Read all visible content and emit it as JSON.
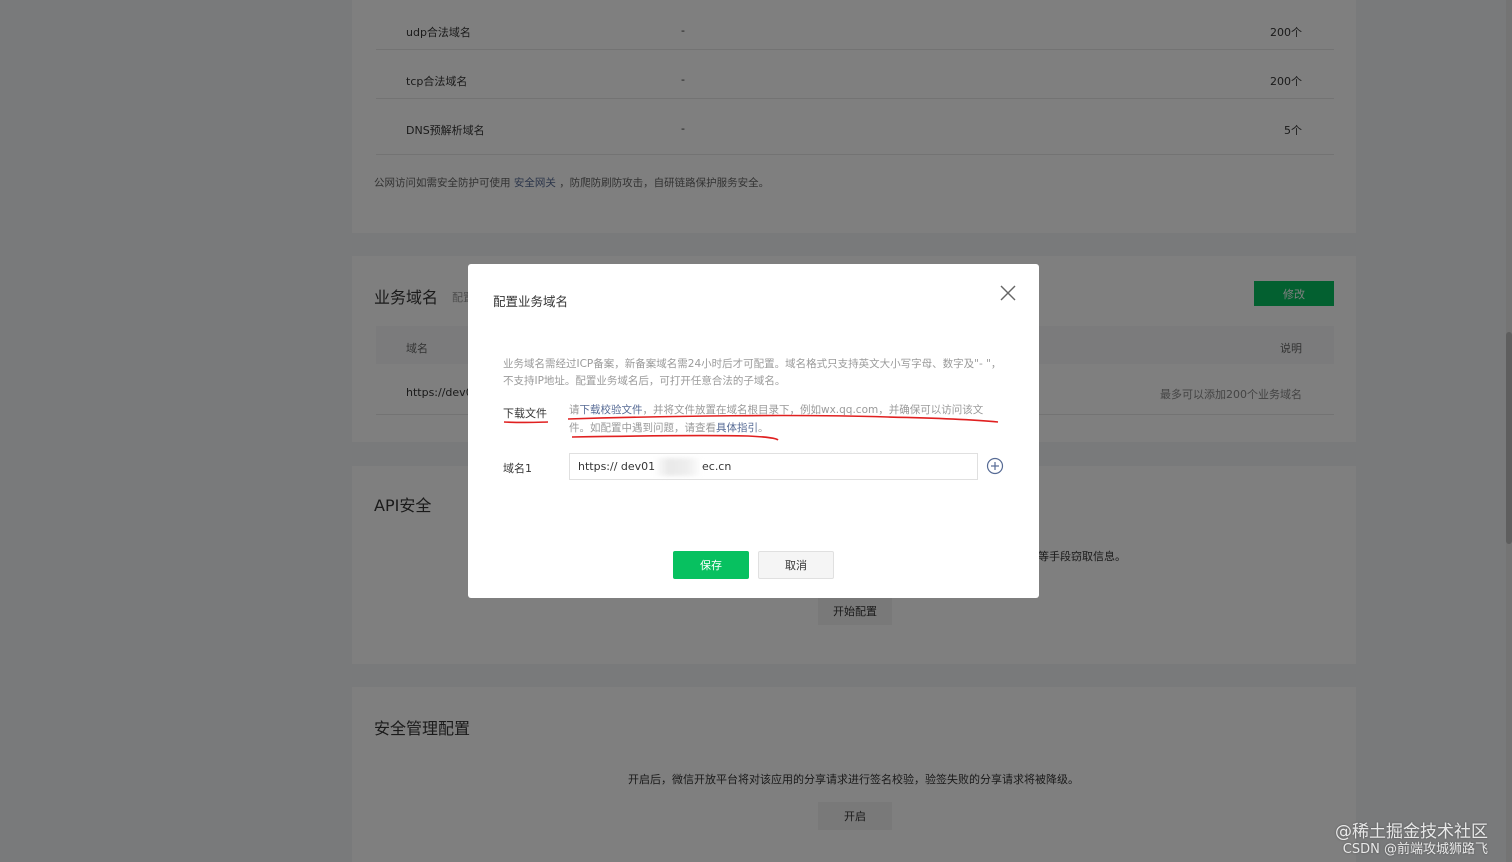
{
  "server_domains": {
    "rows": [
      {
        "name": "udp合法域名",
        "value": "-",
        "count": "200个"
      },
      {
        "name": "tcp合法域名",
        "value": "-",
        "count": "200个"
      },
      {
        "name": "DNS预解析域名",
        "value": "-",
        "count": "5个"
      }
    ],
    "note_prefix": "公网访问如需安全防护可使用",
    "note_link": "安全网关",
    "note_suffix": "，防爬防刷防攻击，自研链路保护服务安全。"
  },
  "business_domain": {
    "title": "业务域名",
    "subtitle": "配置",
    "edit_button": "修改",
    "table_headers": {
      "domain": "域名",
      "desc": "说明"
    },
    "row": {
      "domain": "https://dev0",
      "desc": "最多可以添加200个业务域名"
    }
  },
  "api_security": {
    "title": "API安全",
    "desc_tail": "等手段窃取信息。",
    "start_button": "开始配置"
  },
  "security_mgmt": {
    "title": "安全管理配置",
    "desc": "开启后，微信开放平台将对该应用的分享请求进行签名校验，验签失败的分享请求将被降级。",
    "enable_button": "开启"
  },
  "modal": {
    "title": "配置业务域名",
    "intro": "业务域名需经过ICP备案，新备案域名需24小时后才可配置。域名格式只支持英文大小写字母、数字及\"- \"，不支持IP地址。配置业务域名后，可打开任意合法的子域名。",
    "download_label": "下载文件",
    "guide_p1": "请",
    "guide_link1": "下载校验文件",
    "guide_p2": "，并将文件放置在域名根目录下，例如wx.qq.com，并确保可以访问该文件。如配置中遇到问题，请查看",
    "guide_link2": "具体指引",
    "guide_p3": "。",
    "domain_label": "域名1",
    "domain_value_left": "https:// dev01",
    "domain_value_right": "ec.cn",
    "save_button": "保存",
    "cancel_button": "取消"
  },
  "watermark": {
    "line1": "@稀土掘金技术社区",
    "line2": "CSDN @前端攻城狮路飞"
  },
  "colors": {
    "brand_green": "#07c160",
    "link_blue": "#576b95",
    "annotation_red": "#e02020"
  }
}
